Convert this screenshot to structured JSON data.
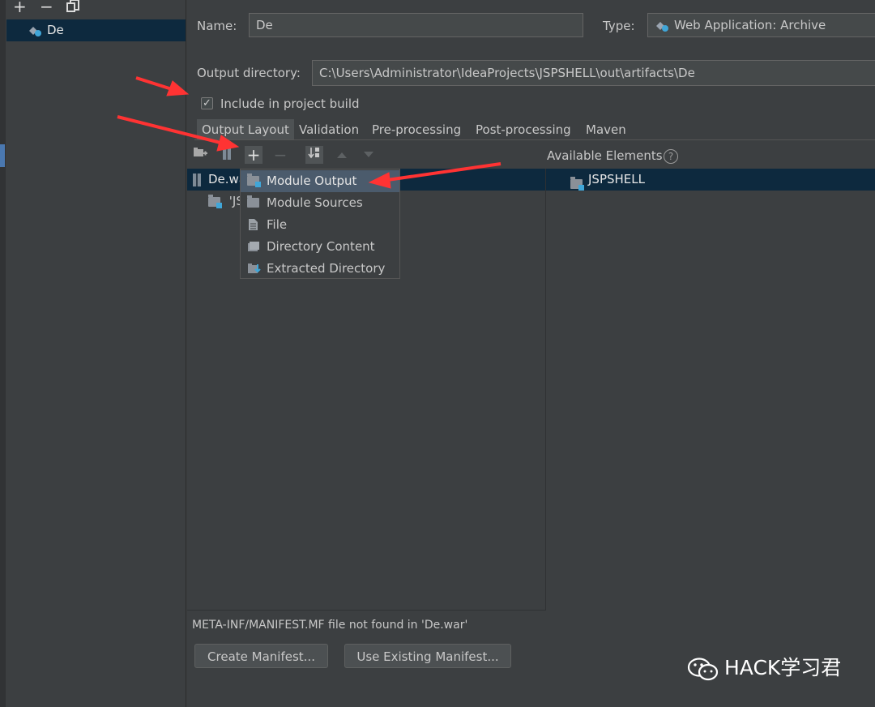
{
  "left_toolbar": {
    "add": "+",
    "remove": "−"
  },
  "artifacts": [
    {
      "label": "De"
    }
  ],
  "form": {
    "name_label": "Name:",
    "name_value": "De",
    "type_label": "Type:",
    "type_value": "Web Application: Archive",
    "output_dir_label": "Output directory:",
    "output_dir_value": "C:\\Users\\Administrator\\IdeaProjects\\JSPSHELL\\out\\artifacts\\De",
    "include_build_label": "Include in project build",
    "include_build_checked": true
  },
  "tabs": [
    {
      "label": "Output Layout",
      "active": true
    },
    {
      "label": "Validation"
    },
    {
      "label": "Pre-processing"
    },
    {
      "label": "Post-processing"
    },
    {
      "label": "Maven"
    }
  ],
  "layout_tree": {
    "root": "De.war",
    "child": "'JS"
  },
  "available": {
    "header": "Available Elements",
    "help": "?",
    "items": [
      "JSPSHELL"
    ]
  },
  "add_menu": [
    {
      "label": "Module Output",
      "icon": "module-output-icon",
      "selected": true
    },
    {
      "label": "Module Sources",
      "icon": "module-sources-icon"
    },
    {
      "label": "File",
      "icon": "file-icon"
    },
    {
      "label": "Directory Content",
      "icon": "directory-content-icon"
    },
    {
      "label": "Extracted Directory",
      "icon": "extracted-directory-icon"
    }
  ],
  "manifest": {
    "message": "META-INF/MANIFEST.MF file not found in 'De.war'",
    "create": "Create Manifest...",
    "use_existing": "Use Existing Manifest..."
  },
  "watermark": "HACK学习君",
  "colors": {
    "background": "#3c3f41",
    "selection": "#0d293e",
    "arrow": "#ff3333"
  }
}
